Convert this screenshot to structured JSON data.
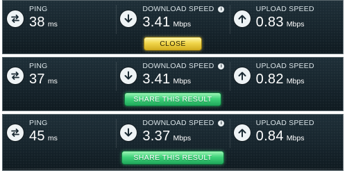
{
  "results": [
    {
      "ping": {
        "label": "PING",
        "value": "38",
        "unit": "ms",
        "icon": "ping-arrows-icon"
      },
      "download": {
        "label": "DOWNLOAD SPEED",
        "value": "3.41",
        "unit": "Mbps",
        "icon": "download-arrow-icon",
        "info_icon": "info-icon"
      },
      "upload": {
        "label": "UPLOAD SPEED",
        "value": "0.83",
        "unit": "Mbps",
        "icon": "upload-arrow-icon"
      },
      "button": {
        "label": "CLOSE",
        "style": "yellow"
      }
    },
    {
      "ping": {
        "label": "PING",
        "value": "37",
        "unit": "ms",
        "icon": "ping-arrows-icon"
      },
      "download": {
        "label": "DOWNLOAD SPEED",
        "value": "3.41",
        "unit": "Mbps",
        "icon": "download-arrow-icon",
        "info_icon": "info-icon"
      },
      "upload": {
        "label": "UPLOAD SPEED",
        "value": "0.82",
        "unit": "Mbps",
        "icon": "upload-arrow-icon"
      },
      "button": {
        "label": "SHARE THIS RESULT",
        "style": "green"
      }
    },
    {
      "ping": {
        "label": "PING",
        "value": "45",
        "unit": "ms",
        "icon": "ping-arrows-icon"
      },
      "download": {
        "label": "DOWNLOAD SPEED",
        "value": "3.37",
        "unit": "Mbps",
        "icon": "download-arrow-icon",
        "info_icon": "info-icon"
      },
      "upload": {
        "label": "UPLOAD SPEED",
        "value": "0.84",
        "unit": "Mbps",
        "icon": "upload-arrow-icon"
      },
      "button": {
        "label": "SHARE THIS RESULT",
        "style": "green"
      }
    }
  ],
  "colors": {
    "panel_bg": "#1a2a33",
    "close_button": "#f0d54a",
    "share_button": "#3fd37a",
    "text": "#ffffff"
  }
}
